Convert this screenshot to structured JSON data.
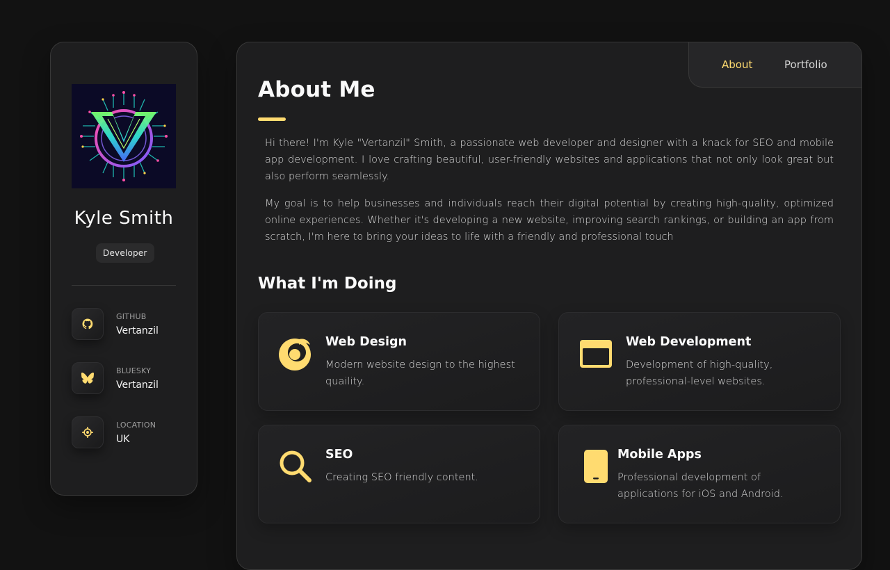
{
  "sidebar": {
    "name": "Kyle Smith",
    "role": "Developer",
    "contacts": [
      {
        "label": "GITHUB",
        "value": "Vertanzil",
        "icon": "github-icon"
      },
      {
        "label": "BLUESKY",
        "value": "Vertanzil",
        "icon": "butterfly-icon"
      },
      {
        "label": "LOCATION",
        "value": "UK",
        "icon": "location-icon"
      }
    ]
  },
  "nav": {
    "items": [
      {
        "label": "About",
        "active": true
      },
      {
        "label": "Portfolio",
        "active": false
      }
    ]
  },
  "about": {
    "title": "About Me",
    "paragraphs": [
      "Hi there! I'm Kyle \"Vertanzil\" Smith, a passionate web developer and designer with a knack for SEO and mobile app development. I love crafting beautiful, user-friendly websites and applications that not only look great but also perform seamlessly.",
      "My goal is to help businesses and individuals reach their digital potential by creating high-quality, optimized online experiences. Whether it's developing a new website, improving search rankings, or building an app from scratch, I'm here to bring your ideas to life with a friendly and professional touch"
    ]
  },
  "services": {
    "title": "What I'm Doing",
    "items": [
      {
        "title": "Web Design",
        "desc": "Modern website design to the highest quaility.",
        "icon": "web-design-icon"
      },
      {
        "title": "Web Development",
        "desc": "Development of high-quality, professional-level websites.",
        "icon": "browser-window-icon"
      },
      {
        "title": "SEO",
        "desc": "Creating SEO friendly content.",
        "icon": "search-icon"
      },
      {
        "title": "Mobile Apps",
        "desc": "Professional development of applications for iOS and Android.",
        "icon": "smartphone-icon"
      }
    ]
  },
  "colors": {
    "accent": "#ffdb70",
    "background": "#121212",
    "card": "#1e1e1f"
  }
}
